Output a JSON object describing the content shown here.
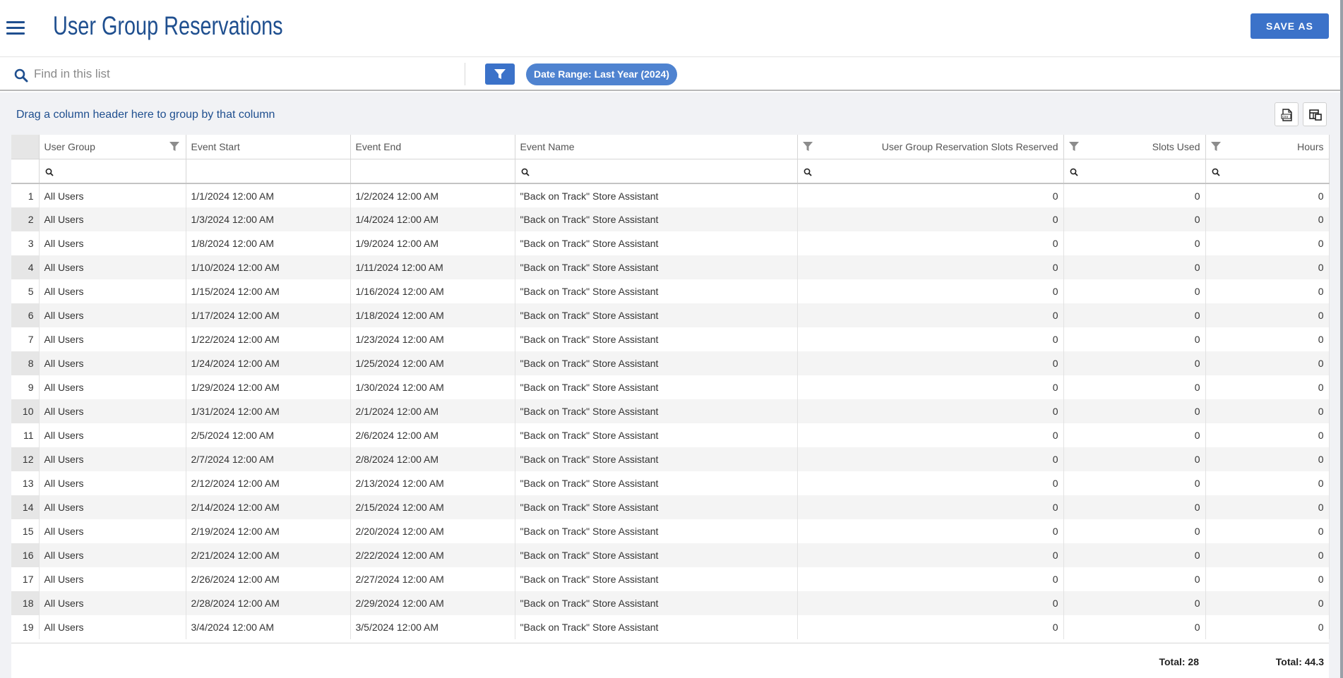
{
  "header": {
    "title": "User Group Reservations",
    "save_as_label": "SAVE AS"
  },
  "toolbar": {
    "search_placeholder": "Find in this list",
    "date_range_chip": "Date Range: Last Year (2024)"
  },
  "grid": {
    "group_hint": "Drag a column header here to group by that column",
    "columns": [
      "User Group",
      "Event Start",
      "Event End",
      "Event Name",
      "User Group Reservation Slots Reserved",
      "Slots Used",
      "Hours"
    ],
    "rows": [
      {
        "n": "1",
        "group": "All Users",
        "start": "1/1/2024 12:00 AM",
        "end": "1/2/2024 12:00 AM",
        "event": "\"Back on Track\" Store Assistant",
        "reserved": "0",
        "used": "0",
        "hours": "0"
      },
      {
        "n": "2",
        "group": "All Users",
        "start": "1/3/2024 12:00 AM",
        "end": "1/4/2024 12:00 AM",
        "event": "\"Back on Track\" Store Assistant",
        "reserved": "0",
        "used": "0",
        "hours": "0"
      },
      {
        "n": "3",
        "group": "All Users",
        "start": "1/8/2024 12:00 AM",
        "end": "1/9/2024 12:00 AM",
        "event": "\"Back on Track\" Store Assistant",
        "reserved": "0",
        "used": "0",
        "hours": "0"
      },
      {
        "n": "4",
        "group": "All Users",
        "start": "1/10/2024 12:00 AM",
        "end": "1/11/2024 12:00 AM",
        "event": "\"Back on Track\" Store Assistant",
        "reserved": "0",
        "used": "0",
        "hours": "0"
      },
      {
        "n": "5",
        "group": "All Users",
        "start": "1/15/2024 12:00 AM",
        "end": "1/16/2024 12:00 AM",
        "event": "\"Back on Track\" Store Assistant",
        "reserved": "0",
        "used": "0",
        "hours": "0"
      },
      {
        "n": "6",
        "group": "All Users",
        "start": "1/17/2024 12:00 AM",
        "end": "1/18/2024 12:00 AM",
        "event": "\"Back on Track\" Store Assistant",
        "reserved": "0",
        "used": "0",
        "hours": "0"
      },
      {
        "n": "7",
        "group": "All Users",
        "start": "1/22/2024 12:00 AM",
        "end": "1/23/2024 12:00 AM",
        "event": "\"Back on Track\" Store Assistant",
        "reserved": "0",
        "used": "0",
        "hours": "0"
      },
      {
        "n": "8",
        "group": "All Users",
        "start": "1/24/2024 12:00 AM",
        "end": "1/25/2024 12:00 AM",
        "event": "\"Back on Track\" Store Assistant",
        "reserved": "0",
        "used": "0",
        "hours": "0"
      },
      {
        "n": "9",
        "group": "All Users",
        "start": "1/29/2024 12:00 AM",
        "end": "1/30/2024 12:00 AM",
        "event": "\"Back on Track\" Store Assistant",
        "reserved": "0",
        "used": "0",
        "hours": "0"
      },
      {
        "n": "10",
        "group": "All Users",
        "start": "1/31/2024 12:00 AM",
        "end": "2/1/2024 12:00 AM",
        "event": "\"Back on Track\" Store Assistant",
        "reserved": "0",
        "used": "0",
        "hours": "0"
      },
      {
        "n": "11",
        "group": "All Users",
        "start": "2/5/2024 12:00 AM",
        "end": "2/6/2024 12:00 AM",
        "event": "\"Back on Track\" Store Assistant",
        "reserved": "0",
        "used": "0",
        "hours": "0"
      },
      {
        "n": "12",
        "group": "All Users",
        "start": "2/7/2024 12:00 AM",
        "end": "2/8/2024 12:00 AM",
        "event": "\"Back on Track\" Store Assistant",
        "reserved": "0",
        "used": "0",
        "hours": "0"
      },
      {
        "n": "13",
        "group": "All Users",
        "start": "2/12/2024 12:00 AM",
        "end": "2/13/2024 12:00 AM",
        "event": "\"Back on Track\" Store Assistant",
        "reserved": "0",
        "used": "0",
        "hours": "0"
      },
      {
        "n": "14",
        "group": "All Users",
        "start": "2/14/2024 12:00 AM",
        "end": "2/15/2024 12:00 AM",
        "event": "\"Back on Track\" Store Assistant",
        "reserved": "0",
        "used": "0",
        "hours": "0"
      },
      {
        "n": "15",
        "group": "All Users",
        "start": "2/19/2024 12:00 AM",
        "end": "2/20/2024 12:00 AM",
        "event": "\"Back on Track\" Store Assistant",
        "reserved": "0",
        "used": "0",
        "hours": "0"
      },
      {
        "n": "16",
        "group": "All Users",
        "start": "2/21/2024 12:00 AM",
        "end": "2/22/2024 12:00 AM",
        "event": "\"Back on Track\" Store Assistant",
        "reserved": "0",
        "used": "0",
        "hours": "0"
      },
      {
        "n": "17",
        "group": "All Users",
        "start": "2/26/2024 12:00 AM",
        "end": "2/27/2024 12:00 AM",
        "event": "\"Back on Track\" Store Assistant",
        "reserved": "0",
        "used": "0",
        "hours": "0"
      },
      {
        "n": "18",
        "group": "All Users",
        "start": "2/28/2024 12:00 AM",
        "end": "2/29/2024 12:00 AM",
        "event": "\"Back on Track\" Store Assistant",
        "reserved": "0",
        "used": "0",
        "hours": "0"
      },
      {
        "n": "19",
        "group": "All Users",
        "start": "3/4/2024 12:00 AM",
        "end": "3/5/2024 12:00 AM",
        "event": "\"Back on Track\" Store Assistant",
        "reserved": "0",
        "used": "0",
        "hours": "0"
      }
    ]
  },
  "totals": {
    "slots_used": "Total: 28",
    "hours": "Total: 44.3"
  },
  "icons": {
    "menu": "hamburger-icon",
    "search": "magnifier-icon",
    "filter": "funnel-icon",
    "export": "csv-export-icon",
    "columns": "column-chooser-icon"
  },
  "colors": {
    "accent": "#3b72c9",
    "chip": "#4f83d0",
    "title": "#1f4f8f"
  }
}
